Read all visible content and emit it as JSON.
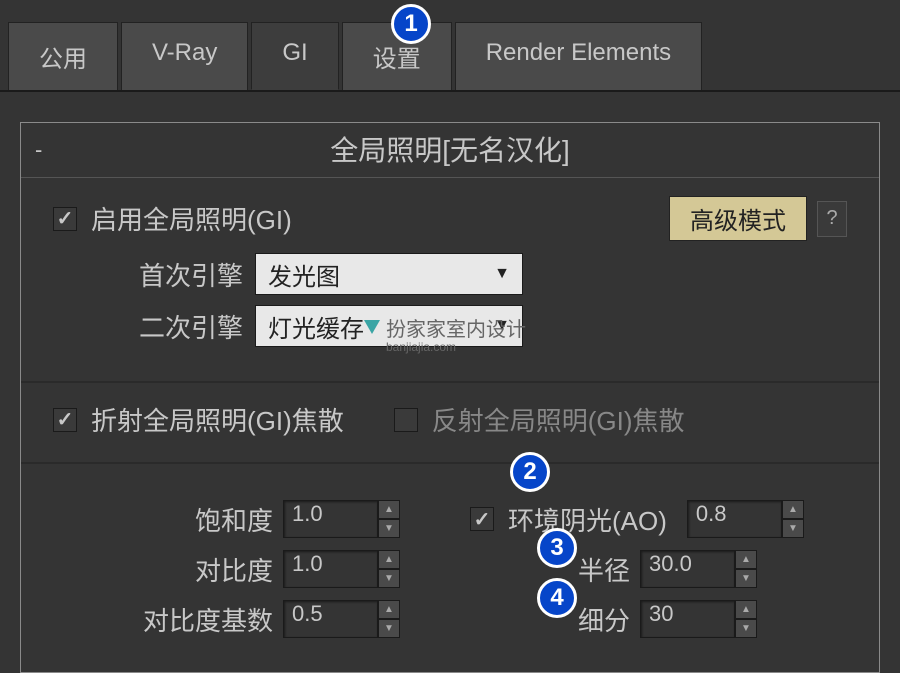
{
  "tabs": {
    "common": "公用",
    "vray": "V-Ray",
    "gi": "GI",
    "settings": "设置",
    "render_elements": "Render Elements"
  },
  "panel": {
    "title": "全局照明[无名汉化]",
    "enable_gi": "启用全局照明(GI)",
    "advanced_mode": "高级模式",
    "help": "?",
    "primary_engine_label": "首次引擎",
    "primary_engine_value": "发光图",
    "secondary_engine_label": "二次引擎",
    "secondary_engine_value": "灯光缓存",
    "watermark_text": "扮家家室内设计",
    "watermark_domain": "banjiajia.com",
    "refract_caustics": "折射全局照明(GI)焦散",
    "reflect_caustics": "反射全局照明(GI)焦散",
    "saturation_label": "饱和度",
    "saturation_value": "1.0",
    "contrast_label": "对比度",
    "contrast_value": "1.0",
    "contrast_base_label": "对比度基数",
    "contrast_base_value": "0.5",
    "ao_label": "环境阴光(AO)",
    "ao_value": "0.8",
    "radius_label": "半径",
    "radius_value": "30.0",
    "subdivs_label": "细分",
    "subdivs_value": "30"
  },
  "badges": {
    "n1": "1",
    "n2": "2",
    "n3": "3",
    "n4": "4"
  }
}
